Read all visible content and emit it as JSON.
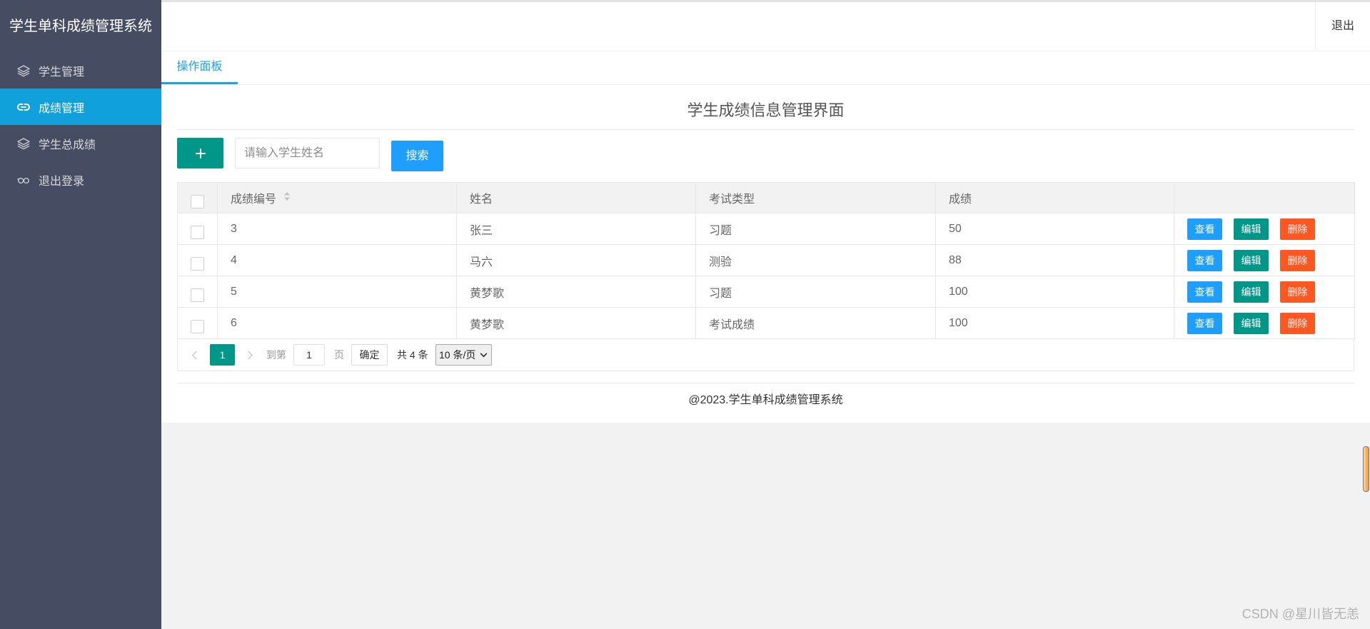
{
  "sidebar": {
    "title": "学生单科成绩管理系统",
    "items": [
      {
        "label": "学生管理",
        "icon": "layers-icon",
        "active": false
      },
      {
        "label": "成绩管理",
        "icon": "link-icon",
        "active": true
      },
      {
        "label": "学生总成绩",
        "icon": "layers-icon",
        "active": false
      },
      {
        "label": "退出登录",
        "icon": "logout-icon",
        "active": false
      }
    ]
  },
  "header": {
    "logout_label": "退出"
  },
  "tabs": [
    {
      "label": "操作面板",
      "active": true
    }
  ],
  "main": {
    "title": "学生成绩信息管理界面",
    "toolbar": {
      "add_icon": "plus-icon",
      "search_placeholder": "请输入学生姓名",
      "search_label": "搜索"
    },
    "table": {
      "select_all_checked": false,
      "columns": [
        {
          "label": "成绩编号",
          "sortable": true
        },
        {
          "label": "姓名",
          "sortable": false
        },
        {
          "label": "考试类型",
          "sortable": false
        },
        {
          "label": "成绩",
          "sortable": false
        }
      ],
      "rows": [
        {
          "id": "3",
          "name": "张三",
          "exam_type": "习题",
          "score": "50",
          "checked": false
        },
        {
          "id": "4",
          "name": "马六",
          "exam_type": "测验",
          "score": "88",
          "checked": false
        },
        {
          "id": "5",
          "name": "黄梦歌",
          "exam_type": "习题",
          "score": "100",
          "checked": false
        },
        {
          "id": "6",
          "name": "黄梦歌",
          "exam_type": "考试成绩",
          "score": "100",
          "checked": false
        }
      ],
      "row_actions": {
        "view": "查看",
        "edit": "编辑",
        "delete": "删除"
      }
    },
    "pagination": {
      "prev_icon": "chevron-left-icon",
      "current_page": "1",
      "next_icon": "chevron-right-icon",
      "goto_prefix": "到第",
      "goto_value": "1",
      "goto_suffix": "页",
      "confirm_label": "确定",
      "total_label": "共 4 条",
      "page_size_selected": "10 条/页"
    }
  },
  "footer": {
    "text": "@2023.学生单科成绩管理系统"
  },
  "watermark": "CSDN @星川皆无恙",
  "colors": {
    "sidebar_bg": "#464c62",
    "menu_active_bg": "#10a0dc",
    "tab_active": "#1aa1e6",
    "primary_green": "#009688",
    "normal_blue": "#1e9fff",
    "danger_orange": "#ff5722"
  }
}
